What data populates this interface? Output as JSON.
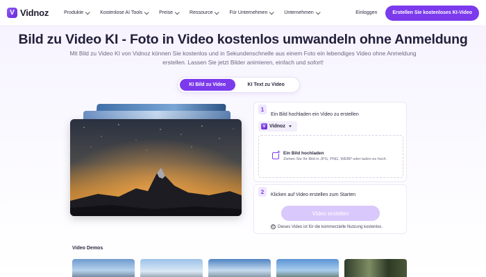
{
  "nav": {
    "logo_text": "Vidnoz",
    "logo_icon": "vidnoz-logo-icon",
    "items": [
      {
        "label": "Produkte"
      },
      {
        "label": "Kostenlose AI Tools"
      },
      {
        "label": "Preise"
      },
      {
        "label": "Ressource"
      },
      {
        "label": "Für Unternehmen"
      },
      {
        "label": "Unternehmen"
      }
    ],
    "login_label": "Einloggen",
    "cta_label": "Erstellen Sie kostenloses KI-Video"
  },
  "hero": {
    "title": "Bild zu Video KI - Foto in Video kostenlos umwandeln ohne Anmeldung",
    "subtitle": "Mit Bild zu Video KI von Vidnoz können Sie kostenlos und in Sekundenschnelle aus einem Foto ein lebendiges Video ohne Anmeldung erstellen. Lassen Sie jetzt Bilder animieren, einfach und sofort!"
  },
  "tabs": [
    {
      "label": "KI Bild zu Video",
      "active": true
    },
    {
      "label": "KI Text zu Video",
      "active": false
    }
  ],
  "step1": {
    "number": "1",
    "title": "Ein Bild hochladen ein Video zu erstellen",
    "select_value": "Vidnoz",
    "upload_title": "Ein Bild hochladen",
    "upload_hint": "Ziehen Sie Ihr Bild in JPG, PNG, WEBP oder laden es hoch"
  },
  "step2": {
    "number": "2",
    "title": "Klicken auf Video erstellen zum Starten",
    "button_label": "Video erstellen",
    "note": "Dieses Video ist für die kommerzielle Nutzung kostenlos."
  },
  "demos": {
    "label": "Video Demos"
  },
  "colors": {
    "accent": "#7c3aed",
    "button_disabled": "#d9c8fb",
    "background": "#f6f2ff"
  }
}
